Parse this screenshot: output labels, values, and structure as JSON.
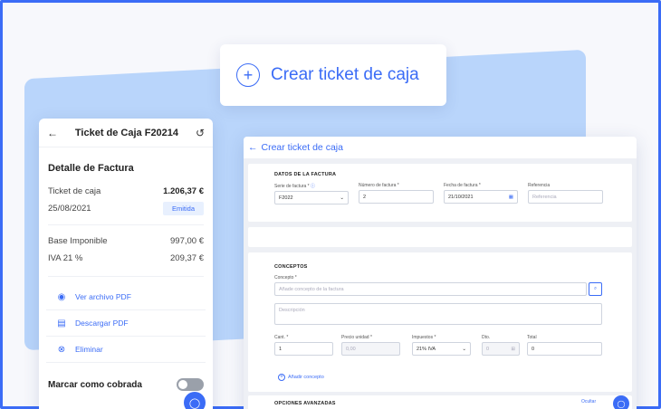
{
  "hero": {
    "title": "Crear ticket de caja",
    "plus": "+"
  },
  "mobile": {
    "back": "←",
    "title": "Ticket de Caja F20214",
    "history": "↺",
    "section": "Detalle de Factura",
    "rows": [
      {
        "label": "Ticket de caja",
        "value": "1.206,37 €"
      },
      {
        "label": "25/08/2021",
        "badge": "Emitida"
      }
    ],
    "totals": [
      {
        "label": "Base Imponible",
        "value": "997,00 €"
      },
      {
        "label": "IVA 21 %",
        "value": "209,37 €"
      }
    ],
    "actions": [
      {
        "icon": "eye-icon",
        "glyph": "◉",
        "label": "Ver archivo PDF"
      },
      {
        "icon": "pdf-icon",
        "glyph": "▤",
        "label": "Descargar PDF"
      },
      {
        "icon": "close-circle-icon",
        "glyph": "⊗",
        "label": "Eliminar"
      }
    ],
    "toggle_label": "Marcar como cobrada"
  },
  "form": {
    "back": "←",
    "title": "Crear ticket de caja",
    "invoice": {
      "section": "DATOS DE LA FACTURA",
      "serie_label": "Serie de factura *",
      "serie_value": "F2022",
      "number_label": "Número de factura *",
      "number_value": "2",
      "date_label": "Fecha de factura *",
      "date_value": "21/10/2021",
      "ref_label": "Referencia",
      "ref_placeholder": "Referencia"
    },
    "concepts": {
      "section": "CONCEPTOS",
      "concept_label": "Concepto *",
      "concept_placeholder": "Añade concepto de la factura",
      "desc_placeholder": "Descripción",
      "qty_label": "Cant. *",
      "qty_value": "1",
      "price_label": "Precio unidad *",
      "price_value": "0,00",
      "tax_label": "Impuestos *",
      "tax_value": "21% IVA",
      "disc_label": "Dto.",
      "disc_value": "0",
      "total_label": "Total",
      "total_value": "0",
      "add_label": "Añadir concepto"
    },
    "advanced": {
      "section": "OPCIONES AVANZADAS",
      "toggle": "Ocultar"
    }
  }
}
